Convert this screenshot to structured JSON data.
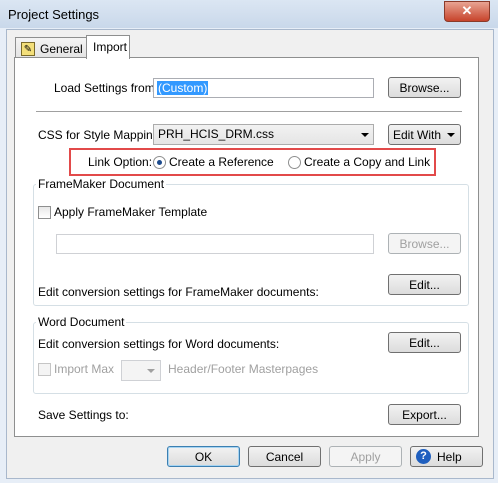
{
  "window": {
    "title": "Project Settings",
    "close_glyph": "✕"
  },
  "tabs": [
    {
      "label": "General",
      "icon": "general-settings-icon"
    },
    {
      "label": "Import"
    }
  ],
  "load_settings": {
    "label": "Load Settings from:",
    "value": "(Custom)",
    "button": "Browse..."
  },
  "css_mapping": {
    "label": "CSS for Style Mapping:",
    "value": "PRH_HCIS_DRM.css",
    "button": "Edit With"
  },
  "link_option": {
    "label": "Link Option:",
    "option1": "Create a Reference",
    "option2": "Create a Copy and Link",
    "selected": "Create a Reference",
    "highlight_color": "#e24a4a"
  },
  "framemaker": {
    "group_title": "FrameMaker Document",
    "checkbox_label": "Apply FrameMaker Template",
    "template_path": "",
    "browse_button": "Browse...",
    "edit_label": "Edit conversion settings for FrameMaker documents:",
    "edit_button": "Edit..."
  },
  "word": {
    "group_title": "Word Document",
    "edit_label": "Edit conversion settings for Word documents:",
    "edit_button": "Edit...",
    "import_max_label": "Import Max",
    "masterpages_label": "Header/Footer Masterpages"
  },
  "save_settings": {
    "label": "Save Settings to:",
    "button": "Export..."
  },
  "footer": {
    "ok": "OK",
    "cancel": "Cancel",
    "apply": "Apply",
    "help": "Help",
    "help_glyph": "?"
  }
}
